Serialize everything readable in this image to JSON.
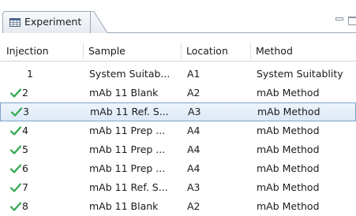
{
  "tab": {
    "title": "Experiment",
    "icon": "table-icon"
  },
  "window_controls": {
    "minimize_icon": "minimize-icon",
    "maximize_icon": "maximize-icon"
  },
  "columns": [
    "Injection",
    "Sample",
    "Location",
    "Method"
  ],
  "rows": [
    {
      "injection": "1",
      "completed": false,
      "sample": "System Suitab...",
      "location": "A1",
      "method": "System Suitablity"
    },
    {
      "injection": "2",
      "completed": true,
      "sample": "mAb 11 Blank",
      "location": "A2",
      "method": "mAb Method"
    },
    {
      "injection": "3",
      "completed": true,
      "sample": "mAb 11 Ref. S...",
      "location": "A3",
      "method": "mAb Method",
      "selected": true
    },
    {
      "injection": "4",
      "completed": true,
      "sample": "mAb 11 Prep ...",
      "location": "A4",
      "method": "mAb Method"
    },
    {
      "injection": "5",
      "completed": true,
      "sample": "mAb 11 Prep ...",
      "location": "A4",
      "method": "mAb Method"
    },
    {
      "injection": "6",
      "completed": true,
      "sample": "mAb 11 Prep ...",
      "location": "A4",
      "method": "mAb Method"
    },
    {
      "injection": "7",
      "completed": true,
      "sample": "mAb 11 Ref. S...",
      "location": "A3",
      "method": "mAb Method"
    },
    {
      "injection": "8",
      "completed": true,
      "sample": "mAb 11 Blank",
      "location": "A2",
      "method": "mAb Method"
    }
  ],
  "colors": {
    "check": "#2fa84f",
    "selected_row": "#dce9f7",
    "selected_border": "#7da2ce"
  }
}
